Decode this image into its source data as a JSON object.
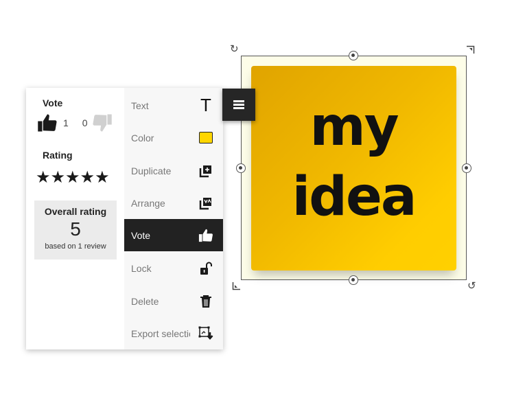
{
  "note": {
    "line1": "my",
    "line2": "idea",
    "colors": {
      "gradient_start": "#e0a400",
      "gradient_end": "#ffd000",
      "frame_bg": "#fdfde8"
    }
  },
  "vote_panel": {
    "vote_heading": "Vote",
    "upvotes": "1",
    "downvotes": "0",
    "rating_heading": "Rating",
    "stars": "★★★★★",
    "star_count": 5,
    "overall": {
      "title": "Overall rating",
      "value": "5",
      "subtitle": "based on 1 review"
    }
  },
  "menu": {
    "items": [
      {
        "label": "Text",
        "icon": "text-icon"
      },
      {
        "label": "Color",
        "icon": "color-swatch-icon",
        "swatch": "#ffd600"
      },
      {
        "label": "Duplicate",
        "icon": "duplicate-icon"
      },
      {
        "label": "Arrange",
        "icon": "arrange-icon"
      },
      {
        "label": "Vote",
        "icon": "thumbs-up-icon",
        "active": true
      },
      {
        "label": "Lock",
        "icon": "unlock-icon"
      },
      {
        "label": "Delete",
        "icon": "trash-icon"
      },
      {
        "label": "Export selection",
        "icon": "export-selection-icon"
      }
    ]
  }
}
